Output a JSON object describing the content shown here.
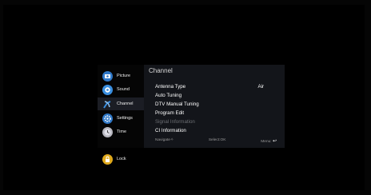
{
  "sidebar": {
    "items": [
      {
        "label": "Picture",
        "icon": "picture-icon",
        "color": "#2f78c8",
        "active": false
      },
      {
        "label": "Sound",
        "icon": "sound-icon",
        "color": "#3a8fe0",
        "active": false
      },
      {
        "label": "Channel",
        "icon": "satellite-dish-icon",
        "color": "#3a8fe0",
        "active": true
      },
      {
        "label": "Settings",
        "icon": "gear-icon",
        "color": "#2f78c8",
        "active": false
      },
      {
        "label": "Time",
        "icon": "clock-icon",
        "color": "#b8b8c0",
        "active": false
      },
      {
        "label": "Lock",
        "icon": "lock-icon",
        "color": "#e0a91c",
        "active": false
      }
    ]
  },
  "panel": {
    "title": "Channel",
    "rows": [
      {
        "label": "Antenna Type",
        "value": "Air",
        "disabled": false
      },
      {
        "label": "Auto Tuning",
        "value": "",
        "disabled": false
      },
      {
        "label": "DTV Manual Tuning",
        "value": "",
        "disabled": false
      },
      {
        "label": "Program Edit",
        "value": "",
        "disabled": false
      },
      {
        "label": "Signal Information",
        "value": "",
        "disabled": true
      },
      {
        "label": "CI Information",
        "value": "",
        "disabled": false
      }
    ],
    "footer": {
      "navigate": "Navigate",
      "select": "Select",
      "select_key": "OK",
      "menu": "Menu"
    }
  }
}
